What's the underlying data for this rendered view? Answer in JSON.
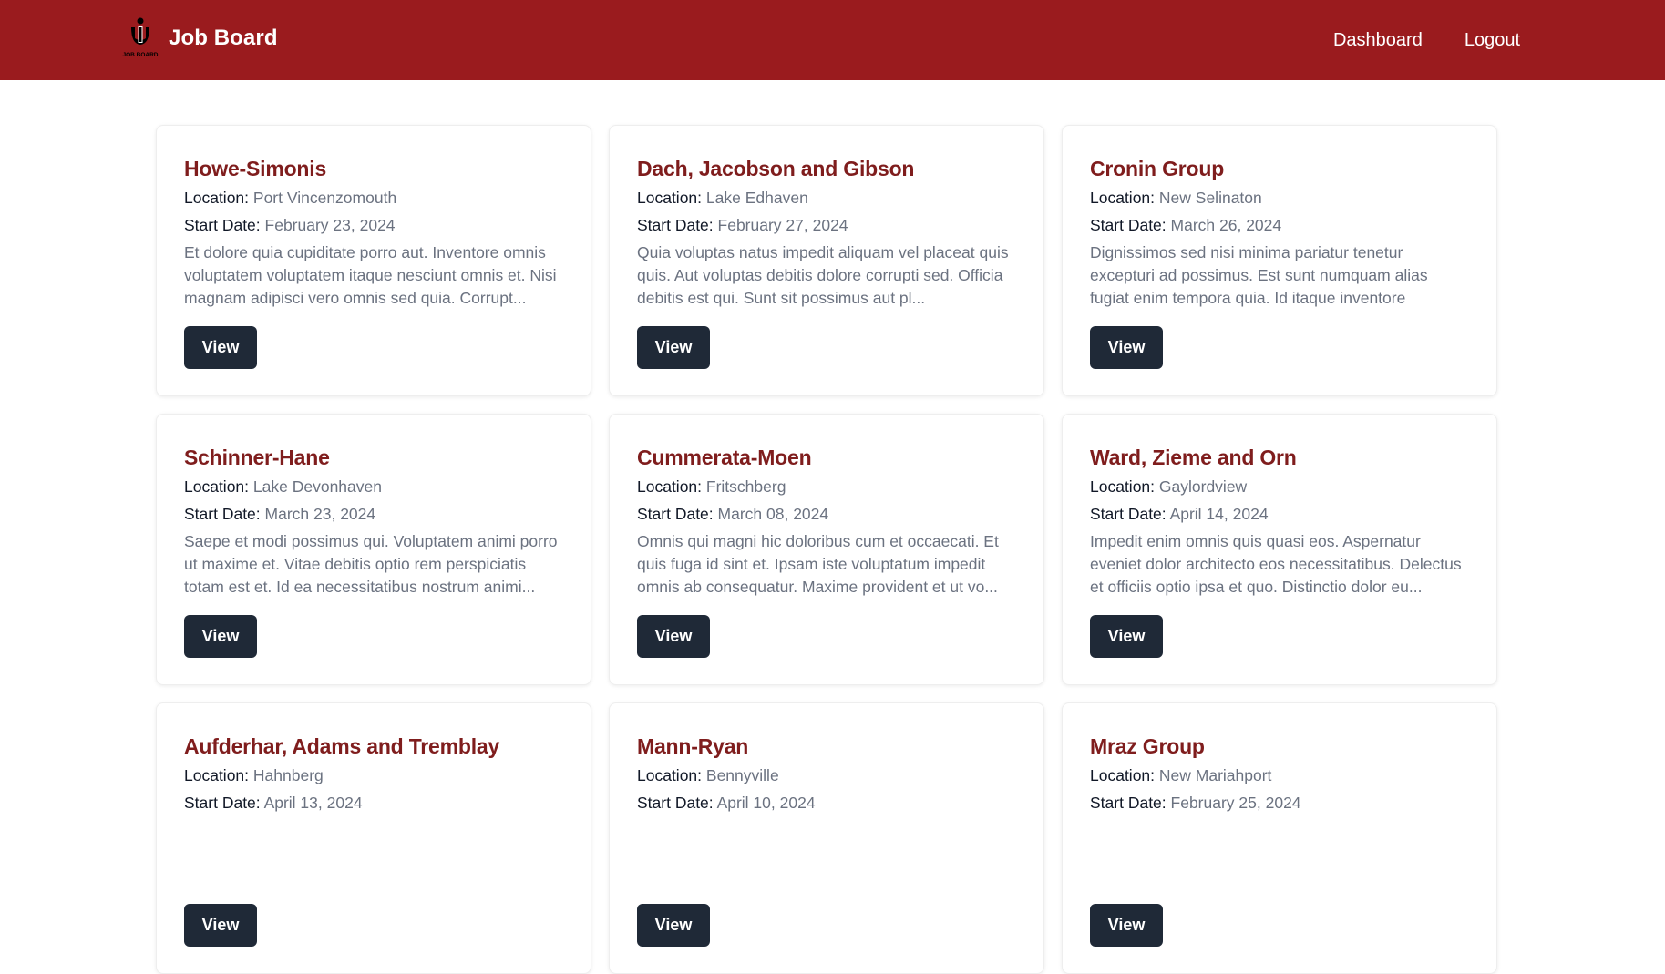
{
  "navbar": {
    "brand_name": "Job Board",
    "logo_text": "JOB BOARD",
    "links": [
      "Dashboard",
      "Logout"
    ],
    "background": "#9a1b1e"
  },
  "jobs": [
    {
      "company": "Howe-Simonis",
      "location_label": "Location:",
      "location": "Port Vincenzomouth",
      "start_label": "Start Date:",
      "start_date": "February 23, 2024",
      "description": "Et dolore quia cupiditate porro aut. Inventore omnis voluptatem voluptatem itaque nesciunt omnis et. Nisi magnam adipisci vero omnis sed quia. Corrupt...",
      "button": "View"
    },
    {
      "company": "Dach, Jacobson and Gibson",
      "location_label": "Location:",
      "location": "Lake Edhaven",
      "start_label": "Start Date:",
      "start_date": "February 27, 2024",
      "description": "Quia voluptas natus impedit aliquam vel placeat quis quis. Aut voluptas debitis dolore corrupti sed. Officia debitis est qui. Sunt sit possimus aut pl...",
      "button": "View"
    },
    {
      "company": "Cronin Group",
      "location_label": "Location:",
      "location": "New Selinaton",
      "start_label": "Start Date:",
      "start_date": "March 26, 2024",
      "description": "Dignissimos sed nisi minima pariatur tenetur excepturi ad possimus. Est sunt numquam alias fugiat enim tempora quia. Id itaque inventore sapiente est ...",
      "button": "View"
    },
    {
      "company": "Schinner-Hane",
      "location_label": "Location:",
      "location": "Lake Devonhaven",
      "start_label": "Start Date:",
      "start_date": "March 23, 2024",
      "description": "Saepe et modi possimus qui. Voluptatem animi porro ut maxime et. Vitae debitis optio rem perspiciatis totam est et. Id ea necessitatibus nostrum animi...",
      "button": "View"
    },
    {
      "company": "Cummerata-Moen",
      "location_label": "Location:",
      "location": "Fritschberg",
      "start_label": "Start Date:",
      "start_date": "March 08, 2024",
      "description": "Omnis qui magni hic doloribus cum et occaecati. Et quis fuga id sint et. Ipsam iste voluptatum impedit omnis ab consequatur. Maxime provident et ut vo...",
      "button": "View"
    },
    {
      "company": "Ward, Zieme and Orn",
      "location_label": "Location:",
      "location": "Gaylordview",
      "start_label": "Start Date:",
      "start_date": "April 14, 2024",
      "description": "Impedit enim omnis quis quasi eos. Aspernatur eveniet dolor architecto eos necessitatibus. Delectus et officiis optio ipsa et quo. Distinctio dolor eu...",
      "button": "View"
    },
    {
      "company": "Aufderhar, Adams and Tremblay",
      "location_label": "Location:",
      "location": "Hahnberg",
      "start_label": "Start Date:",
      "start_date": "April 13, 2024",
      "description": "",
      "button": "View"
    },
    {
      "company": "Mann-Ryan",
      "location_label": "Location:",
      "location": "Bennyville",
      "start_label": "Start Date:",
      "start_date": "April 10, 2024",
      "description": "",
      "button": "View"
    },
    {
      "company": "Mraz Group",
      "location_label": "Location:",
      "location": "New Mariahport",
      "start_label": "Start Date:",
      "start_date": "February 25, 2024",
      "description": "",
      "button": "View"
    }
  ]
}
